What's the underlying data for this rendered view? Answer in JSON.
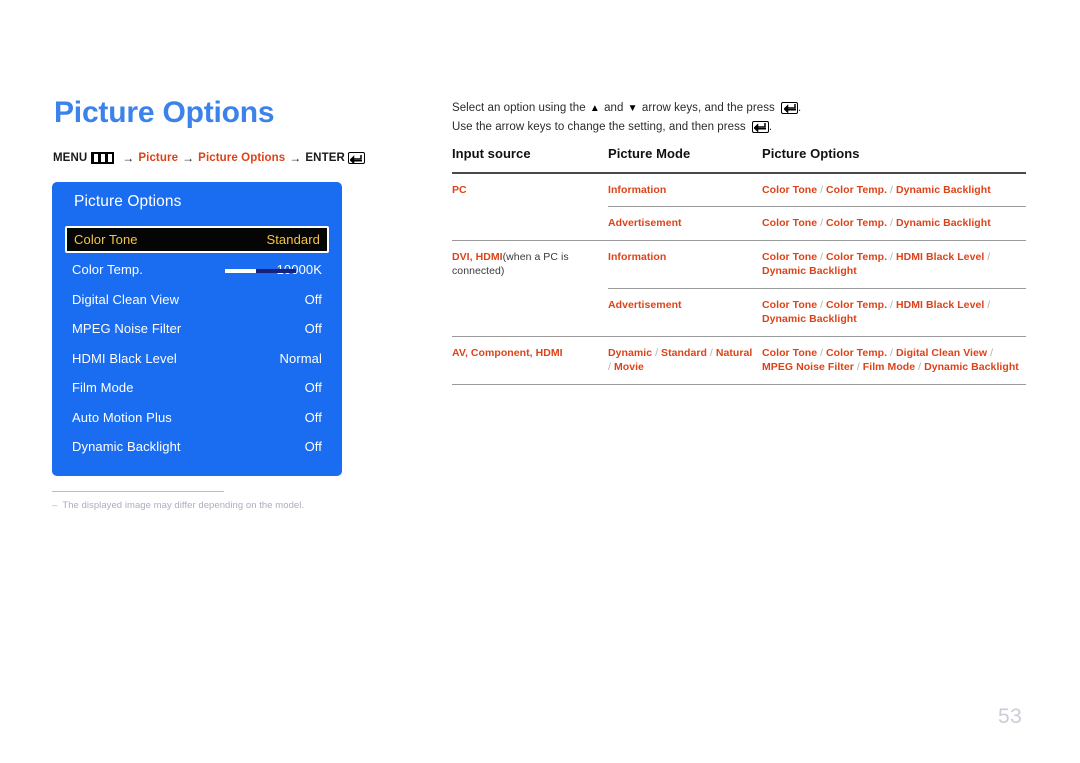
{
  "page": {
    "title": "Picture Options",
    "number": "53",
    "title_color": "#3b82ea",
    "accent_color": "#dd4318",
    "osd_blue": "#1a6cf0"
  },
  "breadcrumb": {
    "menu_label": "MENU",
    "menu_icon": "menu-bars-icon",
    "arrow": "→",
    "step1": "Picture",
    "step2": "Picture Options",
    "enter_label": "ENTER",
    "enter_icon": "enter-return-icon"
  },
  "osd": {
    "title": "Picture Options",
    "rows": [
      {
        "label": "Color Tone",
        "value": "Standard",
        "selected": true,
        "slider": false
      },
      {
        "label": "Color Temp.",
        "value": "10000K",
        "selected": false,
        "slider": true,
        "slider_fill_percent": 43
      },
      {
        "label": "Digital Clean View",
        "value": "Off",
        "selected": false,
        "slider": false
      },
      {
        "label": "MPEG Noise Filter",
        "value": "Off",
        "selected": false,
        "slider": false
      },
      {
        "label": "HDMI Black Level",
        "value": "Normal",
        "selected": false,
        "slider": false
      },
      {
        "label": "Film Mode",
        "value": "Off",
        "selected": false,
        "slider": false
      },
      {
        "label": "Auto Motion Plus",
        "value": "Off",
        "selected": false,
        "slider": false
      },
      {
        "label": "Dynamic Backlight",
        "value": "Off",
        "selected": false,
        "slider": false
      }
    ]
  },
  "footnote": {
    "dash": "–",
    "text": "The displayed image may differ depending on the model."
  },
  "instructions": {
    "line1_a": "Select an option using the ",
    "line1_up": "▲",
    "line1_b": " and ",
    "line1_dn": "▼",
    "line1_c": " arrow keys, and the press ",
    "line1_end": ".",
    "line2_a": "Use the arrow keys to change the setting, and then press ",
    "line2_end": "."
  },
  "table": {
    "headers": [
      "Input source",
      "Picture Mode",
      "Picture Options"
    ],
    "groups": [
      {
        "input_source": "PC",
        "input_source_note": "",
        "rows": [
          {
            "picture_mode": "Information",
            "picture_options": "Color Tone / Color Temp. / Dynamic Backlight"
          },
          {
            "picture_mode": "Advertisement",
            "picture_options": "Color Tone / Color Temp. / Dynamic Backlight"
          }
        ]
      },
      {
        "input_source": "DVI, HDMI",
        "input_source_note": "(when a PC is connected)",
        "rows": [
          {
            "picture_mode": "Information",
            "picture_options": "Color Tone / Color Temp. / HDMI Black Level / Dynamic Backlight"
          },
          {
            "picture_mode": "Advertisement",
            "picture_options": "Color Tone / Color Temp. / HDMI Black Level / Dynamic Backlight"
          }
        ]
      },
      {
        "input_source": "AV, Component, HDMI",
        "input_source_note": "",
        "rows": [
          {
            "picture_mode": "Dynamic / Standard / Natural / Movie",
            "picture_options": "Color Tone / Color Temp. / Digital Clean View / MPEG Noise Filter / Film Mode / Dynamic Backlight"
          }
        ]
      }
    ]
  }
}
